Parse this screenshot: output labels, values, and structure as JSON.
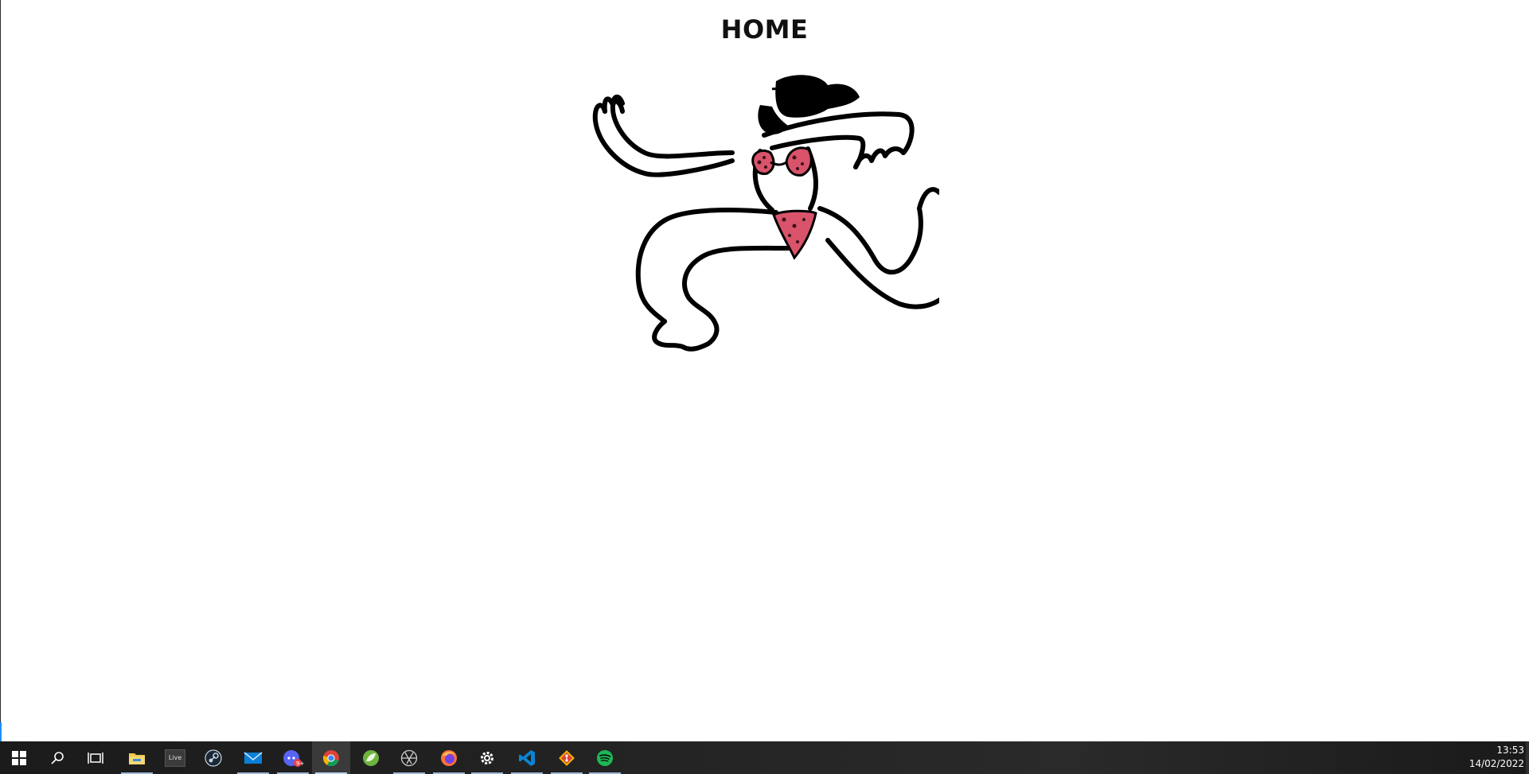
{
  "page": {
    "title": "HOME"
  },
  "hero": {
    "icon": "dancing-figure-illustration"
  },
  "taskbar": {
    "icons": [
      "windows-start-icon",
      "search-icon",
      "task-view-icon",
      "file-explorer-icon",
      "live-app-icon",
      "steam-icon",
      "mail-icon",
      "discord-icon",
      "chrome-icon",
      "spring-icon",
      "aperture-icon",
      "firefox-icon",
      "settings-icon",
      "vscode-icon",
      "git-icon",
      "spotify-icon"
    ],
    "live_label": "Live",
    "discord_badge": "9+",
    "clock": {
      "time": "13:53",
      "date": "14/02/2022"
    }
  },
  "colors": {
    "taskbar_bg": "#1f1f1f",
    "accent": "#1e90ff",
    "bikini": "#d9536a"
  }
}
